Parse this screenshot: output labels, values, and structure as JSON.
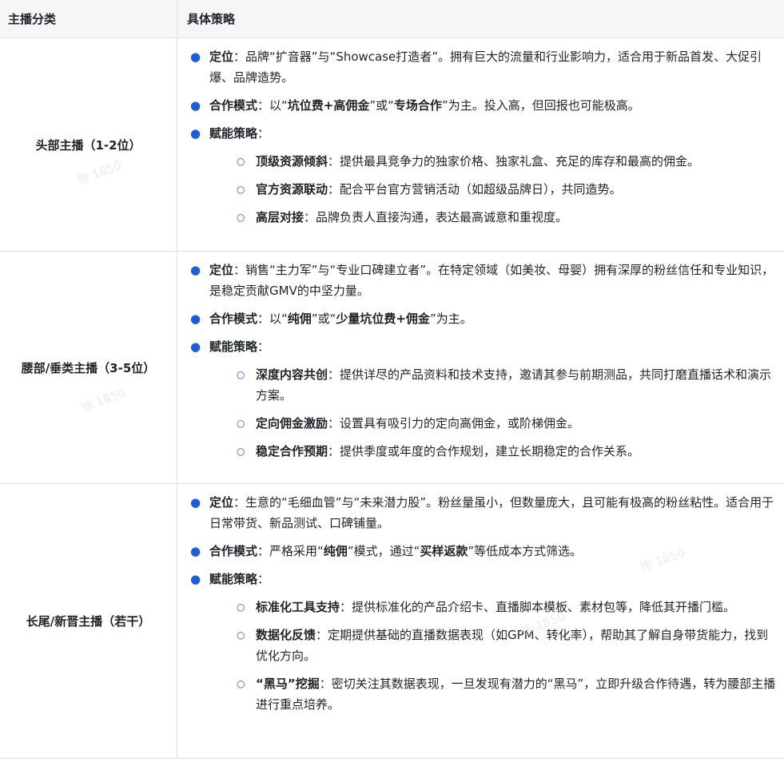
{
  "header": {
    "col1": "主播分类",
    "col2": "具体策略"
  },
  "rows": [
    {
      "category": "头部主播（1-2位）",
      "positioning_label": "定位",
      "positioning_text": "：品牌“扩音器”与“Showcase打造者”。拥有巨大的流量和行业影响力，适合用于新品首发、大促引爆、品牌造势。",
      "mode_label": "合作模式",
      "mode_pre": "：以“",
      "mode_b1": "坑位费+高佣金",
      "mode_mid": "”或“",
      "mode_b2": "专场合作",
      "mode_post": "”为主。投入高，但回报也可能极高。",
      "strategy_label": "赋能策略",
      "strategy_colon": "：",
      "subs": [
        {
          "label": "顶级资源倾斜",
          "text": "：提供最具竞争力的独家价格、独家礼盒、充足的库存和最高的佣金。"
        },
        {
          "label": "官方资源联动",
          "text": "：配合平台官方营销活动（如超级品牌日），共同造势。"
        },
        {
          "label": "高层对接",
          "text": "：品牌负责人直接沟通，表达最高诚意和重视度。"
        }
      ]
    },
    {
      "category": "腰部/垂类主播（3-5位）",
      "positioning_label": "定位",
      "positioning_text": "：销售“主力军”与“专业口碑建立者”。在特定领域（如美妆、母婴）拥有深厚的粉丝信任和专业知识，是稳定贡献GMV的中坚力量。",
      "mode_label": "合作模式",
      "mode_pre": "：以“",
      "mode_b1": "纯佣",
      "mode_mid": "”或“",
      "mode_b2": "少量坑位费+佣金",
      "mode_post": "”为主。",
      "strategy_label": "赋能策略",
      "strategy_colon": "：",
      "subs": [
        {
          "label": "深度内容共创",
          "text": "：提供详尽的产品资料和技术支持，邀请其参与前期测品，共同打磨直播话术和演示方案。"
        },
        {
          "label": "定向佣金激励",
          "text": "：设置具有吸引力的定向高佣金，或阶梯佣金。"
        },
        {
          "label": "稳定合作预期",
          "text": "：提供季度或年度的合作规划，建立长期稳定的合作关系。"
        }
      ]
    },
    {
      "category": "长尾/新晋主播（若干）",
      "positioning_label": "定位",
      "positioning_text": "：生意的“毛细血管”与“未来潜力股”。粉丝量虽小，但数量庞大，且可能有极高的粉丝粘性。适合用于日常带货、新品测试、口碑铺量。",
      "mode_label": "合作模式",
      "mode_pre": "：严格采用“",
      "mode_b1": "纯佣",
      "mode_mid": "”模式，通过“",
      "mode_b2": "买样返款",
      "mode_post": "”等低成本方式筛选。",
      "strategy_label": "赋能策略",
      "strategy_colon": "：",
      "subs": [
        {
          "label": "标准化工具支持",
          "text": "：提供标准化的产品介绍卡、直播脚本模板、素材包等，降低其开播门槛。"
        },
        {
          "label": "数据化反馈",
          "text": "：定期提供基础的直播数据表现（如GPM、转化率），帮助其了解自身带货能力，找到优化方向。"
        },
        {
          "label": "“黑马”挖掘",
          "text": "：密切关注其数据表现，一旦发现有潜力的“黑马”，立即升级合作待遇，转为腰部主播进行重点培养。"
        }
      ]
    }
  ],
  "watermark": "徐 1850"
}
